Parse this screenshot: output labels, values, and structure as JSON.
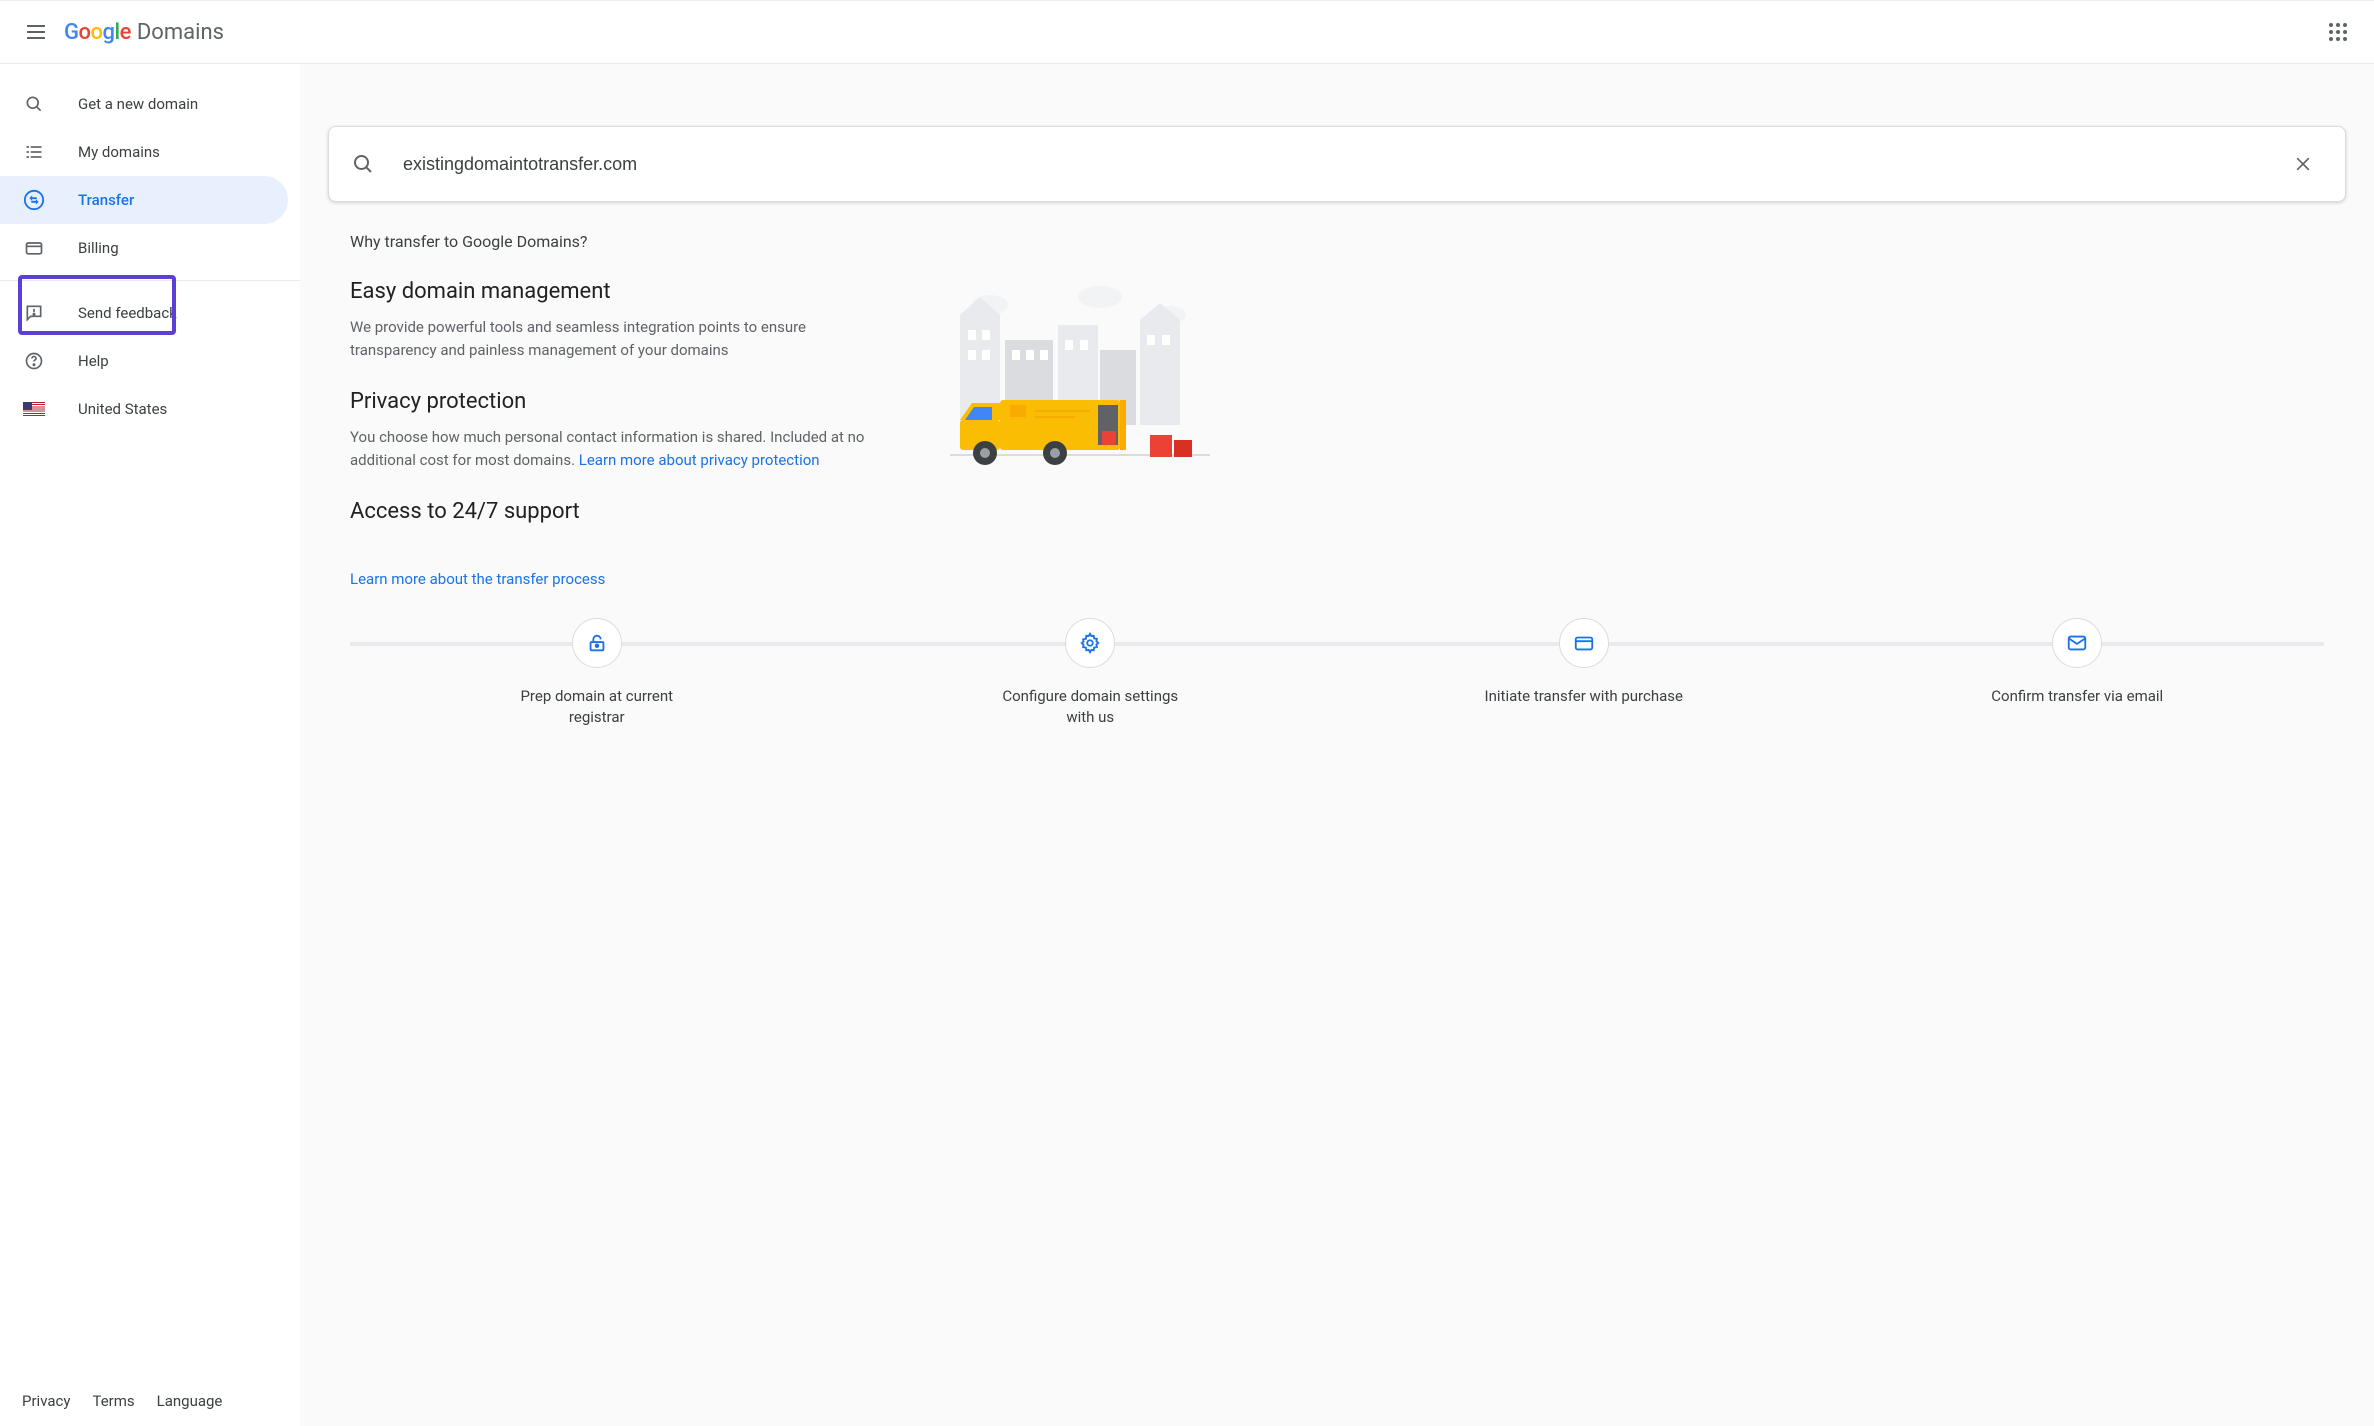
{
  "header": {
    "logo_google": "Google",
    "logo_domains": "Domains"
  },
  "sidebar": {
    "items": [
      {
        "label": "Get a new domain"
      },
      {
        "label": "My domains"
      },
      {
        "label": "Transfer"
      },
      {
        "label": "Billing"
      },
      {
        "label": "Send feedback"
      },
      {
        "label": "Help"
      },
      {
        "label": "United States"
      }
    ],
    "footer": {
      "privacy": "Privacy",
      "terms": "Terms",
      "language": "Language"
    }
  },
  "search": {
    "value": "existingdomaintotransfer.com"
  },
  "main": {
    "why_title": "Why transfer to Google Domains?",
    "features": [
      {
        "title": "Easy domain management",
        "body": "We provide powerful tools and seamless integration points to ensure transparency and painless management of your domains"
      },
      {
        "title": "Privacy protection",
        "body_prefix": "You choose how much personal contact information is shared. Included at no additional cost for most domains. ",
        "link": "Learn more about privacy protection"
      },
      {
        "title": "Access to 24/7 support"
      }
    ],
    "learn_link": "Learn more about the transfer process",
    "steps": [
      {
        "label": "Prep domain at current registrar"
      },
      {
        "label": "Configure domain settings with us"
      },
      {
        "label": "Initiate transfer with purchase"
      },
      {
        "label": "Confirm transfer via email"
      }
    ]
  }
}
